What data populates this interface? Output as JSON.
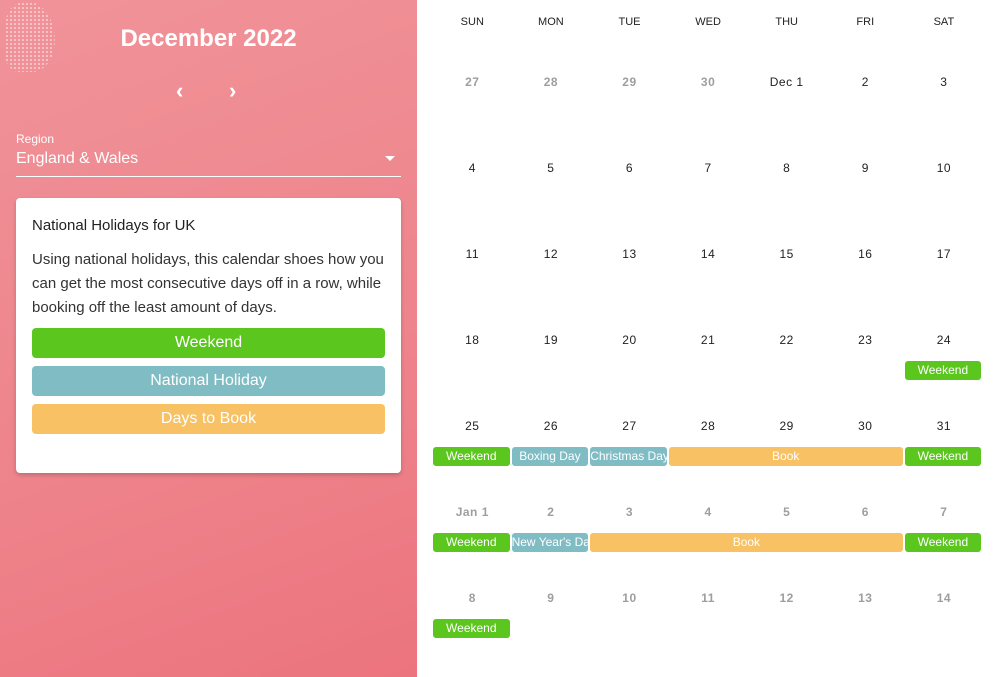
{
  "header": {
    "title": "December 2022",
    "prev_icon": "chevron-left-icon",
    "next_icon": "chevron-right-icon",
    "prev": "‹",
    "next": "›"
  },
  "region": {
    "label": "Region",
    "value": "England & Wales"
  },
  "card": {
    "title": "National Holidays for UK",
    "description": "Using national holidays, this calendar shoes how you can get the most consecutive days off in a row, while booking off the least amount of days.",
    "legend": [
      {
        "label": "Weekend",
        "type": "weekend"
      },
      {
        "label": "National Holiday",
        "type": "holiday"
      },
      {
        "label": "Days to Book",
        "type": "book"
      }
    ]
  },
  "colors": {
    "weekend": "#5ac61e",
    "holiday": "#7fbcc4",
    "book": "#f7c164",
    "current_month_text": "#222222",
    "other_month_text": "#9e9e9e"
  },
  "calendar": {
    "weekdays": [
      "SUN",
      "MON",
      "TUE",
      "WED",
      "THU",
      "FRI",
      "SAT"
    ],
    "weeks": [
      [
        {
          "d": "27",
          "o": true
        },
        {
          "d": "28",
          "o": true
        },
        {
          "d": "29",
          "o": true
        },
        {
          "d": "30",
          "o": true
        },
        {
          "d": "Dec 1"
        },
        {
          "d": "2"
        },
        {
          "d": "3"
        }
      ],
      [
        {
          "d": "4"
        },
        {
          "d": "5"
        },
        {
          "d": "6"
        },
        {
          "d": "7"
        },
        {
          "d": "8"
        },
        {
          "d": "9"
        },
        {
          "d": "10"
        }
      ],
      [
        {
          "d": "11"
        },
        {
          "d": "12"
        },
        {
          "d": "13"
        },
        {
          "d": "14"
        },
        {
          "d": "15"
        },
        {
          "d": "16"
        },
        {
          "d": "17"
        }
      ],
      [
        {
          "d": "18"
        },
        {
          "d": "19"
        },
        {
          "d": "20"
        },
        {
          "d": "21"
        },
        {
          "d": "22"
        },
        {
          "d": "23"
        },
        {
          "d": "24"
        }
      ],
      [
        {
          "d": "25"
        },
        {
          "d": "26"
        },
        {
          "d": "27"
        },
        {
          "d": "28"
        },
        {
          "d": "29"
        },
        {
          "d": "30"
        },
        {
          "d": "31"
        }
      ],
      [
        {
          "d": "Jan 1",
          "o": true
        },
        {
          "d": "2",
          "o": true
        },
        {
          "d": "3",
          "o": true
        },
        {
          "d": "4",
          "o": true
        },
        {
          "d": "5",
          "o": true
        },
        {
          "d": "6",
          "o": true
        },
        {
          "d": "7",
          "o": true
        }
      ],
      [
        {
          "d": "8",
          "o": true
        },
        {
          "d": "9",
          "o": true
        },
        {
          "d": "10",
          "o": true
        },
        {
          "d": "11",
          "o": true
        },
        {
          "d": "12",
          "o": true
        },
        {
          "d": "13",
          "o": true
        },
        {
          "d": "14",
          "o": true
        }
      ]
    ],
    "events": [
      {
        "start": "2022-12-24",
        "days": 1,
        "label": "Weekend",
        "type": "weekend"
      },
      {
        "start": "2022-12-25",
        "days": 1,
        "label": "Weekend",
        "type": "weekend"
      },
      {
        "start": "2022-12-26",
        "days": 1,
        "label": "Boxing Day",
        "type": "holiday"
      },
      {
        "start": "2022-12-27",
        "days": 1,
        "label": "Christmas Day",
        "type": "holiday"
      },
      {
        "start": "2022-12-28",
        "days": 3,
        "label": "Book",
        "type": "book"
      },
      {
        "start": "2022-12-31",
        "days": 1,
        "label": "Weekend",
        "type": "weekend"
      },
      {
        "start": "2023-01-01",
        "days": 1,
        "label": "Weekend",
        "type": "weekend"
      },
      {
        "start": "2023-01-02",
        "days": 1,
        "label": "New Year's Day",
        "type": "holiday"
      },
      {
        "start": "2023-01-03",
        "days": 4,
        "label": "Book",
        "type": "book"
      },
      {
        "start": "2023-01-07",
        "days": 1,
        "label": "Weekend",
        "type": "weekend"
      },
      {
        "start": "2023-01-08",
        "days": 1,
        "label": "Weekend",
        "type": "weekend"
      }
    ]
  }
}
